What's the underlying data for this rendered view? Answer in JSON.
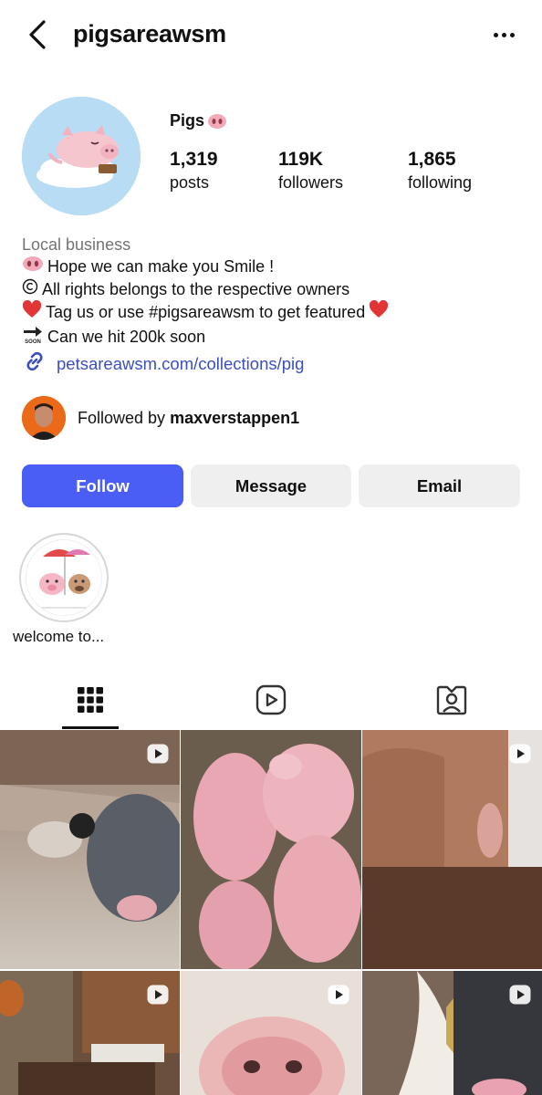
{
  "header": {
    "username": "pigsareawsm"
  },
  "profile": {
    "display_name": "Pigs",
    "stats": [
      {
        "value": "1,319",
        "label": "posts"
      },
      {
        "value": "119K",
        "label": "followers"
      },
      {
        "value": "1,865",
        "label": "following"
      }
    ]
  },
  "bio": {
    "category": "Local business",
    "line1": "Hope we can make you Smile !",
    "line2": "All rights belongs to the respective owners",
    "line3": "Tag us or use #pigsareawsm to get featured",
    "line4": "Can we hit 200k soon",
    "link": "petsareawsm.com/collections/pig"
  },
  "followed_by": {
    "prefix": "Followed by",
    "user": "maxverstappen1"
  },
  "actions": {
    "follow": "Follow",
    "message": "Message",
    "email": "Email"
  },
  "highlights": [
    {
      "label": "welcome to..."
    }
  ],
  "tabs": [
    {
      "icon": "grid-icon",
      "active": true
    },
    {
      "icon": "reels-icon",
      "active": false
    },
    {
      "icon": "tagged-icon",
      "active": false
    }
  ],
  "colors": {
    "accent": "#4a5df5",
    "link": "#3b4fbf",
    "secondary_text": "#737373",
    "button_bg": "#efeff0"
  }
}
